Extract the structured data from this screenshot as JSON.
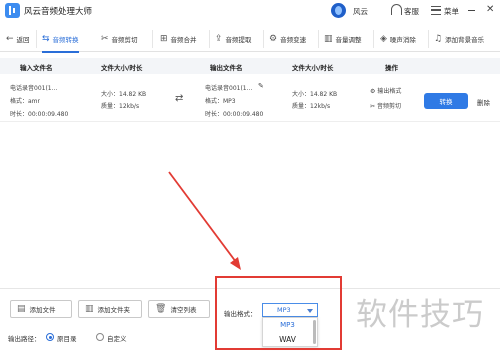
{
  "app": {
    "title": "风云音频处理大师",
    "user": "风云",
    "service": "客服",
    "menu": "菜单",
    "close_glyph": "✕"
  },
  "toolbar": {
    "back": "返回",
    "items": [
      {
        "label": "音频转换",
        "icon": "convert-icon",
        "active": true
      },
      {
        "label": "音频剪切",
        "icon": "cut-icon"
      },
      {
        "label": "音频合并",
        "icon": "merge-icon"
      },
      {
        "label": "音频提取",
        "icon": "extract-icon"
      },
      {
        "label": "音频变速",
        "icon": "speed-icon"
      },
      {
        "label": "音量调整",
        "icon": "volume-icon"
      },
      {
        "label": "噪声消除",
        "icon": "noise-icon"
      },
      {
        "label": "添加背景音乐",
        "icon": "music-icon"
      }
    ]
  },
  "table": {
    "headers": [
      "输入文件名",
      "文件大小/时长",
      "输出文件名",
      "文件大小/时长",
      "操作"
    ],
    "rows": [
      {
        "input_name": "电话录音001(1...",
        "input_format": "格式：amr",
        "input_duration": "时长：00:00:09.480",
        "input_size": "大小：14.82 KB",
        "input_quality": "质量：12kb/s",
        "output_name": "电话录音001(1...",
        "output_format": "格式：MP3",
        "output_duration": "时长：00:00:09.480",
        "output_size": "大小：14.82 KB",
        "output_quality": "质量：12kb/s",
        "output_format_btn": "输出格式",
        "audio_cut_btn": "音频剪切",
        "convert": "转换",
        "delete": "删除"
      }
    ]
  },
  "bottom": {
    "add_file": "添加文件",
    "add_folder": "添加文件夹",
    "clear_list": "清空列表",
    "output_format_label": "输出格式：",
    "selected_format": "MP3",
    "options": [
      "MP3",
      "WAV"
    ],
    "output_path_label": "输出路径：",
    "path_original": "原目录",
    "path_custom": "自定义"
  },
  "watermark": "软件技巧",
  "colors": {
    "accent": "#2f7ae5",
    "highlight": "#e23b34"
  }
}
